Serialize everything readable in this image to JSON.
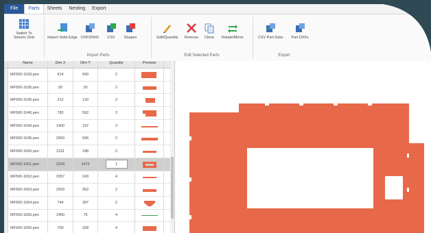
{
  "menu": {
    "file": "File",
    "parts": "Parts",
    "sheets": "Sheets",
    "nesting": "Nesting",
    "export": "Export"
  },
  "ribbon": {
    "switch_label_1": "Switch To",
    "switch_label_2": "Simeric Grid",
    "import_solid_edge": "Import Solid Edge",
    "dxf_dwg": "DXF/DWG",
    "csv": "CSV",
    "shapes": "Shapes",
    "import_parts_group": "Import Parts",
    "edit_quantity": "Edit/Quantity",
    "remove": "Remove",
    "clone": "Clone",
    "rotate_mirror": "Rotate/Mirror",
    "edit_selected_group": "Edit Selected Parts",
    "csv_part_data": "CSV Part Data",
    "part_dxfs": "Part DXFs",
    "export_group": "Export"
  },
  "grid": {
    "headers": {
      "name": "Name",
      "dim_x": "Dim X",
      "dim_y": "Dim Y",
      "quantity": "Quantity",
      "preview": "Preview"
    },
    "rows": [
      {
        "name": "MF500-1633.pen",
        "x": "914",
        "y": "500",
        "q": "2"
      },
      {
        "name": "MF500-1635.pen",
        "x": "50",
        "y": "20",
        "q": "2"
      },
      {
        "name": "MF500-1636.pen",
        "x": "212",
        "y": "120",
        "q": "2"
      },
      {
        "name": "MF500-1640.pen",
        "x": "782",
        "y": "592",
        "q": "2"
      },
      {
        "name": "MF500-1643.pen",
        "x": "1400",
        "y": "197",
        "q": "2"
      },
      {
        "name": "MF500-1645.pen",
        "x": "2900",
        "y": "606",
        "q": "2"
      },
      {
        "name": "MF500-1650.pen",
        "x": "1331",
        "y": "188",
        "q": "2"
      },
      {
        "name": "MF500-1651.pen",
        "x": "2234",
        "y": "1472",
        "q": "1"
      },
      {
        "name": "MF500-1652.pen",
        "x": "2057",
        "y": "243",
        "q": "4"
      },
      {
        "name": "MF500-1653.pen",
        "x": "2003",
        "y": "352",
        "q": "2"
      },
      {
        "name": "MF500-1654.pen",
        "x": "744",
        "y": "287",
        "q": "2"
      },
      {
        "name": "MF500-1655.pen",
        "x": "1450",
        "y": "76",
        "q": "4"
      },
      {
        "name": "MF500-1656.pen",
        "x": "700",
        "y": "328",
        "q": "4"
      }
    ]
  },
  "colors": {
    "part": "#e8694a",
    "ribbon_blue": "#2b579a"
  }
}
